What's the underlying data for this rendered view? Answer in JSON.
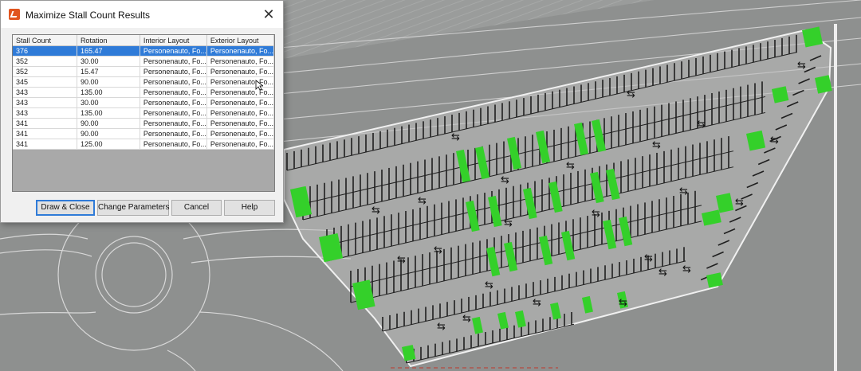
{
  "dialog": {
    "title": "Maximize Stall Count Results",
    "app_icon": "app-logo-icon",
    "close_label": "✕",
    "columns": [
      "Stall Count",
      "Rotation",
      "Interior Layout",
      "Exterior Layout"
    ],
    "rows": [
      {
        "stall_count": "376",
        "rotation": "165.47",
        "interior": "Personenauto, Fo...",
        "exterior": "Personenauto, Fo..."
      },
      {
        "stall_count": "352",
        "rotation": "30.00",
        "interior": "Personenauto, Fo...",
        "exterior": "Personenauto, Fo..."
      },
      {
        "stall_count": "352",
        "rotation": "15.47",
        "interior": "Personenauto, Fo...",
        "exterior": "Personenauto, Fo..."
      },
      {
        "stall_count": "345",
        "rotation": "90.00",
        "interior": "Personenauto, Fo...",
        "exterior": "Personenauto, Fo..."
      },
      {
        "stall_count": "343",
        "rotation": "135.00",
        "interior": "Personenauto, Fo...",
        "exterior": "Personenauto, Fo..."
      },
      {
        "stall_count": "343",
        "rotation": "30.00",
        "interior": "Personenauto, Fo...",
        "exterior": "Personenauto, Fo..."
      },
      {
        "stall_count": "343",
        "rotation": "135.00",
        "interior": "Personenauto, Fo...",
        "exterior": "Personenauto, Fo..."
      },
      {
        "stall_count": "341",
        "rotation": "90.00",
        "interior": "Personenauto, Fo...",
        "exterior": "Personenauto, Fo..."
      },
      {
        "stall_count": "341",
        "rotation": "90.00",
        "interior": "Personenauto, Fo...",
        "exterior": "Personenauto, Fo..."
      },
      {
        "stall_count": "341",
        "rotation": "125.00",
        "interior": "Personenauto, Fo...",
        "exterior": "Personenauto, Fo..."
      }
    ],
    "selected_row": 0,
    "buttons": {
      "draw_close": "Draw & Close",
      "change_parameters": "Change Parameters",
      "cancel": "Cancel",
      "help": "Help"
    }
  },
  "map": {
    "stall_highlight_color": "#34d02a",
    "stall_line_color": "#1f1f1f",
    "boundary_color": "#f0f0f0",
    "traffic_arrow_icon": "two-way-arrow-icon"
  }
}
